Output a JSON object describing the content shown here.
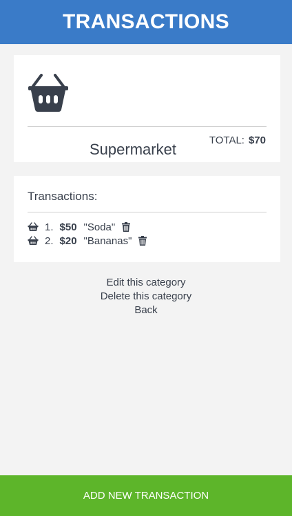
{
  "header": {
    "title": "TRANSACTIONS"
  },
  "category": {
    "icon": "basket-icon",
    "name": "Supermarket",
    "total_label": "TOTAL:",
    "total_value": "$70"
  },
  "transactions": {
    "title": "Transactions:",
    "items": [
      {
        "icon": "basket-icon",
        "index": "1.",
        "amount": "$50",
        "note": "\"Soda\"",
        "delete_icon": "trash-icon"
      },
      {
        "icon": "basket-icon",
        "index": "2.",
        "amount": "$20",
        "note": "\"Bananas\"",
        "delete_icon": "trash-icon"
      }
    ]
  },
  "links": {
    "edit": "Edit this category",
    "delete": "Delete this category",
    "back": "Back"
  },
  "footer": {
    "add_button": "ADD NEW TRANSACTION"
  },
  "colors": {
    "header_bg": "#3a7bc8",
    "add_button_bg": "#5db52a",
    "text": "#39404c",
    "page_bg": "#f3f3f3"
  }
}
